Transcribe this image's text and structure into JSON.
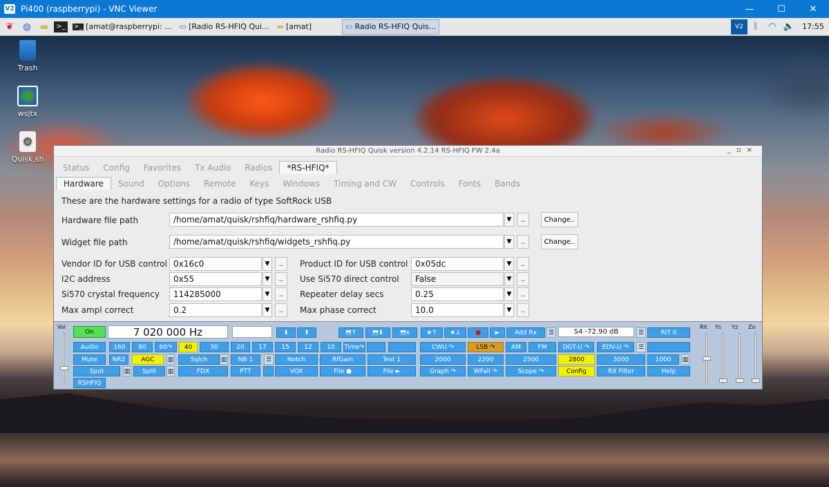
{
  "window": {
    "title": "Pi400 (raspberrypi) - VNC Viewer",
    "logo": "V2",
    "minimize": "—",
    "maximize": "☐",
    "close": "✕"
  },
  "taskbar": {
    "tasks": [
      "[amat@raspberrypi: ...",
      "[Radio RS-HFIQ  Qui...",
      "[amat]",
      "Radio RS-HFIQ  Quis..."
    ],
    "clock": "17:55"
  },
  "desktop": {
    "icons": [
      {
        "label": "Trash"
      },
      {
        "label": "wsjtx"
      },
      {
        "label": "Quisk.sh"
      }
    ]
  },
  "quisk": {
    "title": "Radio RS-HFIQ  Quisk version 4.2.14  RS-HFIQ FW 2.4a",
    "tabs": [
      "Status",
      "Config",
      "Favorites",
      "Tx Audio",
      "Radios",
      "*RS-HFIQ*"
    ],
    "subtabs": [
      "Hardware",
      "Sound",
      "Options",
      "Remote",
      "Keys",
      "Windows",
      "Timing and CW",
      "Controls",
      "Fonts",
      "Bands"
    ],
    "intro": "These are the hardware settings for a radio of type SoftRock USB",
    "hw_path_label": "Hardware file path",
    "hw_path": "/home/amat/quisk/rshfiq/hardware_rshfiq.py",
    "widget_path_label": "Widget file path",
    "widget_path": "/home/amat/quisk/rshfiq/widgets_rshfiq.py",
    "change": "Change..",
    "dots": "..",
    "vendor_label": "Vendor ID for USB control",
    "vendor": "0x16c0",
    "product_label": "Product ID for USB control",
    "product": "0x05dc",
    "i2c_label": "I2C address",
    "i2c": "0x55",
    "si570_label": "Use Si570 direct control",
    "si570": "False",
    "crystal_label": "Si570 crystal frequency",
    "crystal": "114285000",
    "repeater_label": "Repeater delay secs",
    "repeater": "0.25",
    "ampl_label": "Max ampl correct",
    "ampl": "0.2",
    "phase_label": "Max phase correct",
    "phase": "10.0"
  },
  "radio": {
    "vol": "Vol",
    "on": "On",
    "freq": "7 020 000 Hz",
    "smeter": "S4    -72.90 dB",
    "rit_btn": "RIT 0",
    "rit_labels": [
      "Rit",
      "Ys",
      "Yz",
      "Zo"
    ],
    "row1": [
      "⬇",
      "⬆",
      "⬒↑",
      "⬒⬇",
      "⬒x",
      "★↑",
      "★↓",
      "●",
      "►",
      "Add Rx"
    ],
    "row2": [
      "Audio",
      "160",
      "80",
      "60↷",
      "40",
      "30",
      "20",
      "17",
      "15",
      "12",
      "10",
      "Time↷",
      "CWU ↷",
      "LSB ↷",
      "AM",
      "FM",
      "DGT-U ↷",
      "EDV-U ↷"
    ],
    "row3": [
      "Mute",
      "NR2",
      "AGC",
      "Sqlch",
      "NB 1",
      "Notch",
      "RfGain",
      "Test 1",
      "2000",
      "2200",
      "2500",
      "2800",
      "3000",
      "1000"
    ],
    "row4": [
      "Spot",
      "Split",
      "FDX",
      "PTT",
      "VOX",
      "File ●",
      "File ►",
      "Graph ↷",
      "WFall ↷",
      "Scope ↷",
      "Config",
      "RX Filter",
      "Help"
    ],
    "row5": [
      "RSHFIQ"
    ]
  }
}
